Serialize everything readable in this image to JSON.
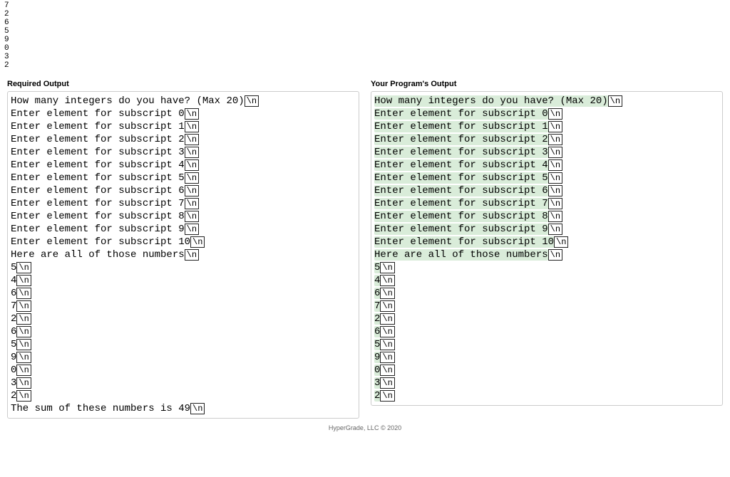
{
  "input_values": [
    "7",
    "2",
    "6",
    "5",
    "9",
    "0",
    "3",
    "2"
  ],
  "nl_marker": "\\n",
  "headers": {
    "required": "Required Output",
    "yours": "Your Program's Output"
  },
  "required_lines": [
    "How many integers do you have? (Max 20)",
    "Enter element for subscript 0",
    "Enter element for subscript 1",
    "Enter element for subscript 2",
    "Enter element for subscript 3",
    "Enter element for subscript 4",
    "Enter element for subscript 5",
    "Enter element for subscript 6",
    "Enter element for subscript 7",
    "Enter element for subscript 8",
    "Enter element for subscript 9",
    "Enter element for subscript 10",
    "Here are all of those numbers",
    "5",
    "4",
    "6",
    "7",
    "2",
    "6",
    "5",
    "9",
    "0",
    "3",
    "2",
    "The sum of these numbers is 49"
  ],
  "your_lines": [
    "How many integers do you have? (Max 20)",
    "Enter element for subscript 0",
    "Enter element for subscript 1",
    "Enter element for subscript 2",
    "Enter element for subscript 3",
    "Enter element for subscript 4",
    "Enter element for subscript 5",
    "Enter element for subscript 6",
    "Enter element for subscript 7",
    "Enter element for subscript 8",
    "Enter element for subscript 9",
    "Enter element for subscript 10",
    "Here are all of those numbers",
    "5",
    "4",
    "6",
    "7",
    "2",
    "6",
    "5",
    "9",
    "0",
    "3",
    "2"
  ],
  "footer": "HyperGrade, LLC © 2020"
}
